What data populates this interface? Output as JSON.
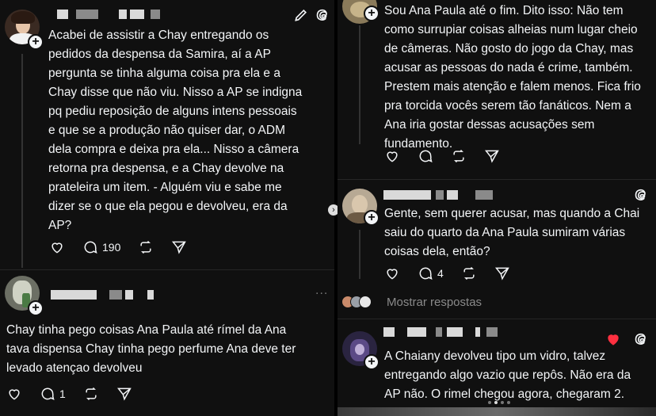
{
  "left": {
    "post1": {
      "text": "Acabei de assistir a Chay entregando os\npedidos da despensa da Samira, aí a AP\npergunta se tinha alguma coisa pra ela e a\nChay disse que não viu. Nisso a AP se indigna\npq pediu reposição de alguns intens pessoais\ne que se a produção não quiser dar, o ADM\ndela compra e deixa pra ela... Nisso a câmera\nretorna pra despensa, e a Chay devolve na\nprateleira um item. -  Alguém viu e sabe me\ndizer se o que ela pegou e devolveu, era da\nAP?",
      "reply_count": "190"
    },
    "post2": {
      "text": "Chay tinha pego coisas Ana Paula até rímel da Ana\ntava dispensa Chay tinha pego perfume Ana deve ter\nlevado atençao devolveu",
      "reply_count": "1",
      "more": "..."
    }
  },
  "right": {
    "post1": {
      "text": "Sou Ana Paula até o fim. Dito isso: Não tem\ncomo surrupiar coisas alheias num lugar cheio\nde câmeras. Não gosto do jogo da Chay, mas\nacusar as pessoas do nada é crime, também.\nPrestem mais atenção e falem menos. Fica frio\npra torcida vocês serem tão fanáticos. Nem a\nAna iria gostar dessas acusações sem\nfundamento."
    },
    "post2": {
      "text": "Gente, sem querer acusar, mas quando a Chai\nsaiu do quarto da Ana Paula sumiram várias\ncoisas dela, então?",
      "reply_count": "4",
      "show_replies": "Mostrar respostas"
    },
    "post3": {
      "text": "A Chaiany devolveu tipo um vidro, talvez\nentregando algo vazio que repôs. Não era da\nAP não. O rimel chegou agora, chegaram 2."
    }
  },
  "icons": {
    "like": "heart-icon",
    "reply": "comment-icon",
    "repost": "repost-icon",
    "share": "send-icon",
    "edit": "pencil-icon",
    "threads": "threads-logo-icon"
  },
  "colors": {
    "background": "#101010",
    "text": "#f3f5f7",
    "muted": "#8a8a8a",
    "like_red": "#ff3040"
  }
}
